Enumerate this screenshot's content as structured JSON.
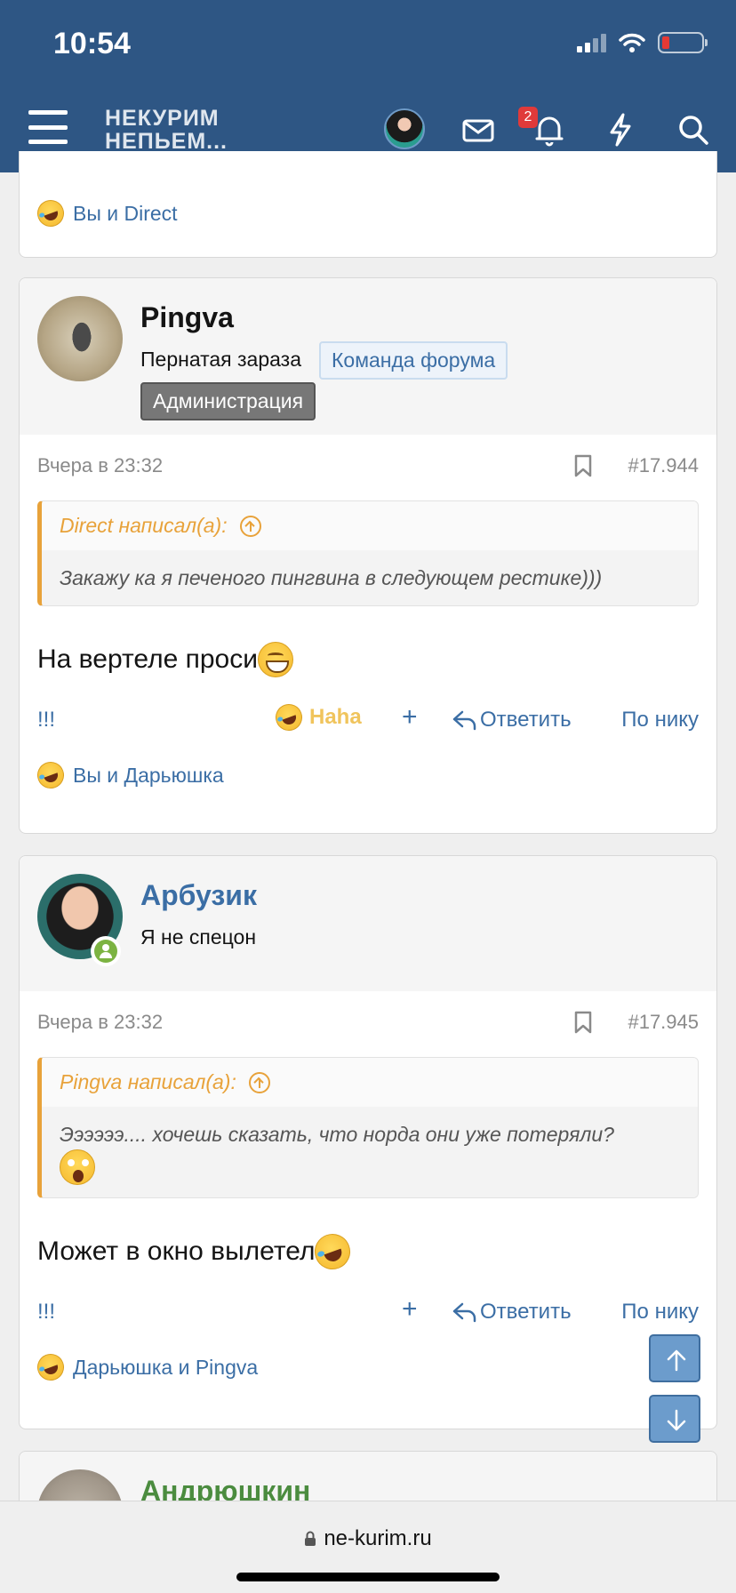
{
  "status": {
    "time": "10:54"
  },
  "header": {
    "logo_line1": "НЕКУРИМ",
    "logo_line2": "НЕПЬЕМ...",
    "notif_count": "2"
  },
  "card0": {
    "reactions": "Вы и Direct"
  },
  "posts": [
    {
      "username": "Pingva",
      "user_title": "Пернатая зараза",
      "banner_team": "Команда форума",
      "banner_admin": "Администрация",
      "date": "Вчера в 23:32",
      "number": "#17.944",
      "quote_author": "Direct написал(а):",
      "quote_text": "Закажу ка я печеного пингвина в следующем рестике)))",
      "text": "На вертеле проси",
      "bang": "!!!",
      "haha": "Haha",
      "plus": "+",
      "reply": "Ответить",
      "by_nick": "По нику",
      "reactions": "Вы и Дарьюшка"
    },
    {
      "username": "Арбузик",
      "user_title": "Я не спецон",
      "date": "Вчера в 23:32",
      "number": "#17.945",
      "quote_author": "Pingva написал(а):",
      "quote_text": "Ээээээ.... хочешь сказать, что норда они уже потеряли?",
      "text": "Может в окно вылетел",
      "bang": "!!!",
      "plus": "+",
      "reply": "Ответить",
      "by_nick": "По нику",
      "reactions": "Дарьюшка и Pingva"
    },
    {
      "username": "Андрюшкин"
    }
  ],
  "browser": {
    "url": "ne-kurim.ru"
  }
}
